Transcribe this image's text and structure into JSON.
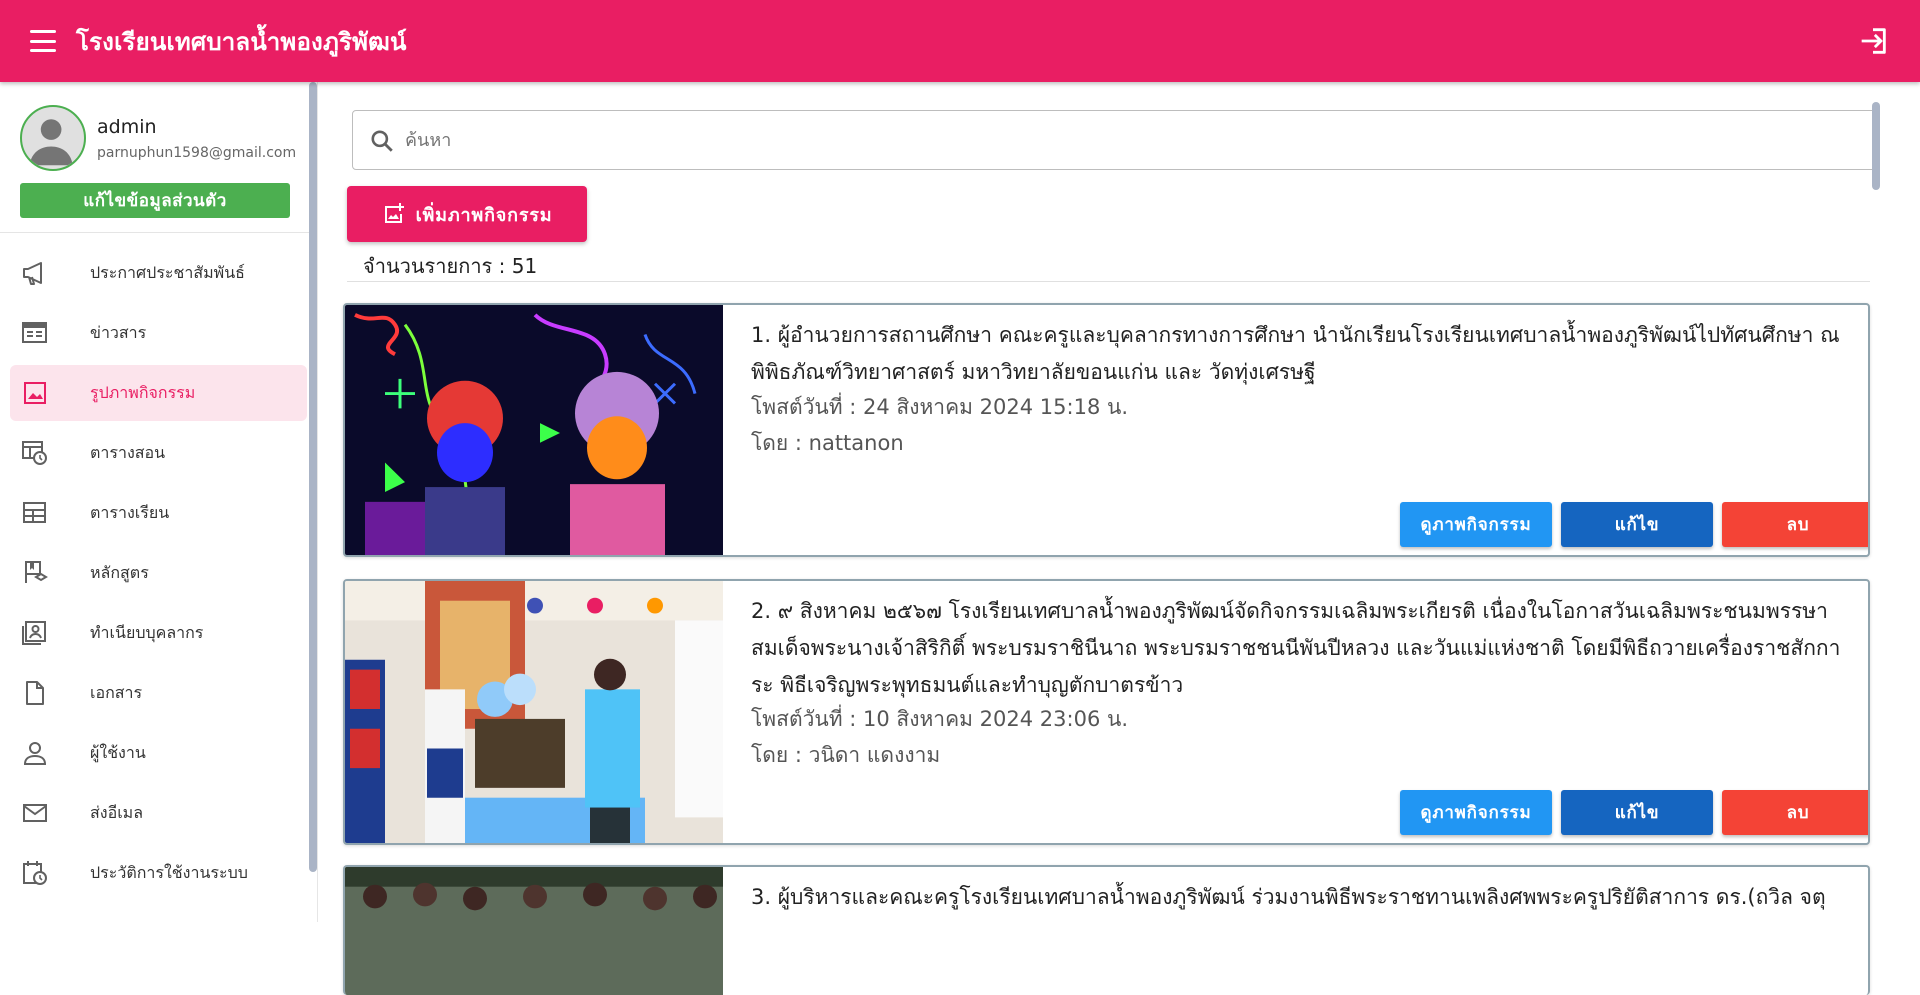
{
  "app": {
    "title": "โรงเรียนเทศบาลน้ำพองภูริพัฒน์"
  },
  "user": {
    "name": "admin",
    "email": "parnuphun1598@gmail.com",
    "edit_label": "แก้ไขข้อมูลส่วนตัว"
  },
  "sidebar": {
    "items": [
      {
        "label": "ประกาศประชาสัมพันธ์",
        "icon": "megaphone-icon"
      },
      {
        "label": "ข่าวสาร",
        "icon": "newspaper-icon"
      },
      {
        "label": "รูปภาพกิจกรรม",
        "icon": "image-icon",
        "active": true
      },
      {
        "label": "ตารางสอน",
        "icon": "calendar-clock-icon"
      },
      {
        "label": "ตารางเรียน",
        "icon": "table-icon"
      },
      {
        "label": "หลักสูตร",
        "icon": "book-icon"
      },
      {
        "label": "ทำเนียบบุคลากร",
        "icon": "contact-card-icon"
      },
      {
        "label": "เอกสาร",
        "icon": "document-icon"
      },
      {
        "label": "ผู้ใช้งาน",
        "icon": "person-icon"
      },
      {
        "label": "ส่งอีเมล",
        "icon": "mail-icon"
      },
      {
        "label": "ประวัติการใช้งานระบบ",
        "icon": "history-icon"
      }
    ]
  },
  "search": {
    "placeholder": "ค้นหา",
    "value": ""
  },
  "toolbar": {
    "add_label": "เพิ่มภาพกิจกรรม",
    "count_label": "จำนวนรายการ : 51"
  },
  "cards": [
    {
      "title": "1. ผู้อำนวยการสถานศึกษา คณะครูและบุคลากรทางการศึกษา นำนักเรียนโรงเรียนเทศบาลน้ำพองภูริพัฒน์ไปทัศนศึกษา ณ พิพิธภัณฑ์วิทยาศาสตร์ มหาวิทยาลัยขอนแก่น และ วัดทุ่งเศรษฐี",
      "posted": "โพสต์วันที่ : 24 สิงหาคม 2024 15:18 น.",
      "author": "โดย : nattanon"
    },
    {
      "title": "2. ๙ สิงหาคม ๒๕๖๗ โรงเรียนเทศบาลน้ำพองภูริพัฒน์จัดกิจกรรมเฉลิมพระเกียรติ เนื่องในโอกาสวันเฉลิมพระชนมพรรษา สมเด็จพระนางเจ้าสิริกิติ์ พระบรมราชินีนาถ พระบรมราชชนนีพันปีหลวง และวันแม่แห่งชาติ โดยมีพิธีถวายเครื่องราชสักการะ พิธีเจริญพระพุทธมนต์และทำบุญตักบาตรข้าว",
      "posted": "โพสต์วันที่ : 10 สิงหาคม 2024 23:06 น.",
      "author": "โดย : วนิดา แดงงาม"
    },
    {
      "title": "3. ผู้บริหารและคณะครูโรงเรียนเทศบาลน้ำพองภูริพัฒน์ ร่วมงานพิธีพระราชทานเพลิงศพพระครูปริยัติสาการ ดร.(ถวิล จตุ"
    }
  ],
  "card_buttons": {
    "view": "ดูภาพกิจกรรม",
    "edit": "แก้ไข",
    "delete": "ลบ"
  }
}
